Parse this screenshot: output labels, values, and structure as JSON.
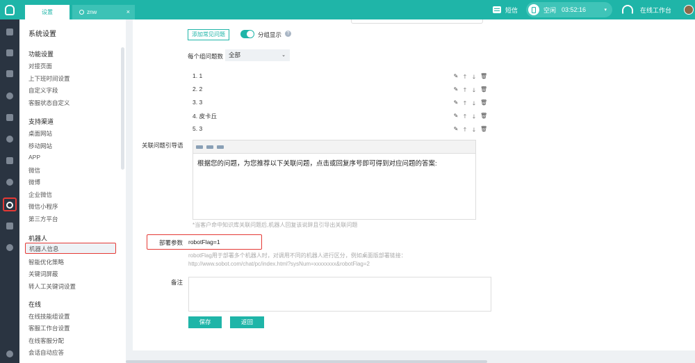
{
  "header": {
    "tabs": [
      {
        "label": "设置"
      },
      {
        "label": "znw"
      }
    ],
    "tab_close": "×",
    "sms_label": "短信",
    "status": {
      "label": "空闲",
      "time": "03:52:16",
      "caret": "▾"
    },
    "workbench_label": "在线工作台"
  },
  "sidebar": {
    "title": "系统设置",
    "sections": [
      {
        "title": "功能设置",
        "items": [
          "对接页面",
          "上下班时间设置",
          "自定义字段",
          "客服状态自定义"
        ]
      },
      {
        "title": "支持渠道",
        "items": [
          "桌面网站",
          "移动网站",
          "APP",
          "微信",
          "微博",
          "企业微信",
          "微信小程序",
          "第三方平台"
        ]
      },
      {
        "title": "机器人",
        "items": [
          "机器人信息",
          "智能优化策略",
          "关键词屏蔽",
          "转人工关键词设置"
        ]
      },
      {
        "title": "在线",
        "items": [
          "在线技能组设置",
          "客服工作台设置",
          "在线客服分配",
          "会话自动应答"
        ]
      }
    ],
    "selected_item": "机器人信息"
  },
  "main": {
    "add_faq_button": "添加常见问题",
    "group_display_label": "分组显示",
    "help_icon": "?",
    "per_group_label": "每个组问题数",
    "per_group_value": "全部",
    "questions": [
      "1. 1",
      "2. 2",
      "3. 3",
      "4. 皮卡丘",
      "5. 3"
    ],
    "related_label": "关联问题引导语",
    "related_text": "根据您的问题，为您推荐以下关联问题，点击或回复序号即可得到对应问题的答案:",
    "related_hint": "*当客户命中知识库关联问题后,机器人回复该说辞且引导出关联问题",
    "deploy_label": "部署参数",
    "deploy_value": "robotFlag=1",
    "deploy_desc_line1": "robotFlag用于部署多个机器人时，对调用不同的机器人进行区分，例如桌面版部署链接：",
    "deploy_desc_line2": "http://www.sobot.com/chat/pc/index.html?sysNum=xxxxxxxx&robotFlag=2",
    "remark_label": "备注",
    "save_button": "保存",
    "back_button": "返回"
  },
  "colors": {
    "accent": "#1fb5a8",
    "highlight": "#e53935",
    "rail": "#2a3441"
  }
}
